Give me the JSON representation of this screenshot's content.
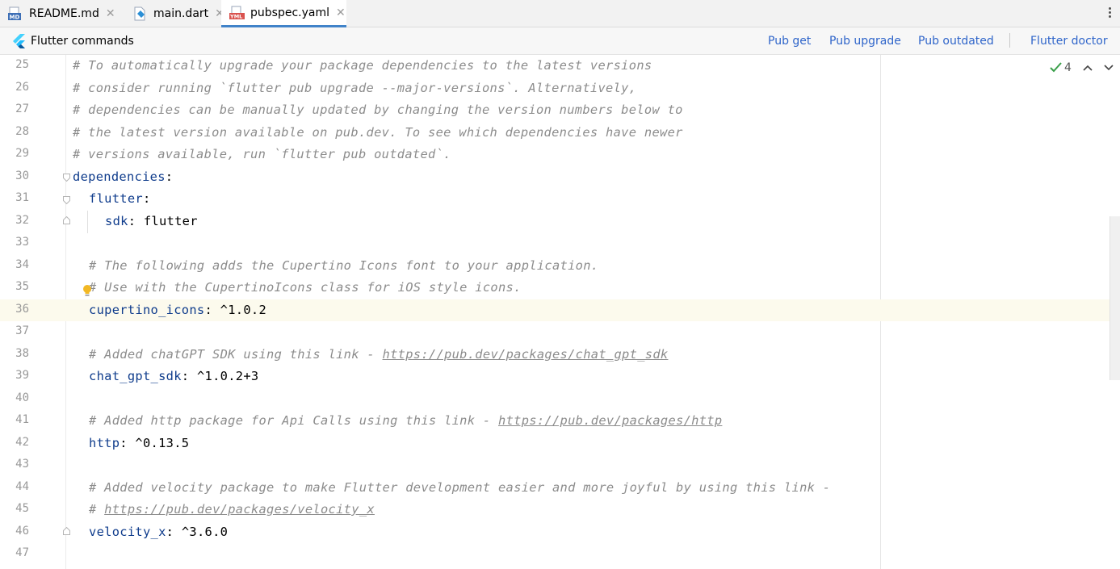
{
  "tabs": [
    {
      "label": "README.md",
      "icon": "markdown-file-icon",
      "active": false
    },
    {
      "label": "main.dart",
      "icon": "dart-file-icon",
      "active": false
    },
    {
      "label": "pubspec.yaml",
      "icon": "yaml-file-icon",
      "active": true
    }
  ],
  "icons": {
    "markdown_badge": "MD",
    "yaml_badge": "YML"
  },
  "commands": {
    "title": "Flutter commands",
    "pub_get": "Pub get",
    "pub_upgrade": "Pub upgrade",
    "pub_outdated": "Pub outdated",
    "flutter_doctor": "Flutter doctor"
  },
  "inspection": {
    "count": "4"
  },
  "lines": [
    {
      "n": "25",
      "text": "# To automatically upgrade your package dependencies to the latest versions"
    },
    {
      "n": "26",
      "text": "# consider running `flutter pub upgrade --major-versions`. Alternatively,"
    },
    {
      "n": "27",
      "text": "# dependencies can be manually updated by changing the version numbers below to"
    },
    {
      "n": "28",
      "text": "# the latest version available on pub.dev. To see which dependencies have newer"
    },
    {
      "n": "29",
      "text": "# versions available, run `flutter pub outdated`."
    },
    {
      "n": "30",
      "key": "dependencies",
      "sep": ":",
      "value": ""
    },
    {
      "n": "31",
      "key": "flutter",
      "sep": ":",
      "value": ""
    },
    {
      "n": "32",
      "key": "sdk",
      "sep": ":",
      "value": " flutter"
    },
    {
      "n": "33"
    },
    {
      "n": "34",
      "text": "# The following adds the Cupertino Icons font to your application."
    },
    {
      "n": "35",
      "text": "# Use with the CupertinoIcons class for iOS style icons."
    },
    {
      "n": "36",
      "key": "cupertino_icons",
      "sep": ":",
      "value": " ^1.0.2"
    },
    {
      "n": "37"
    },
    {
      "n": "38",
      "text": "# Added chatGPT SDK using this link - ",
      "link": "https://pub.dev/packages/chat_gpt_sdk"
    },
    {
      "n": "39",
      "key": "chat_gpt_sdk",
      "sep": ":",
      "value": " ^1.0.2+3"
    },
    {
      "n": "40"
    },
    {
      "n": "41",
      "text": "# Added http package for Api Calls using this link - ",
      "link": "https://pub.dev/packages/http"
    },
    {
      "n": "42",
      "key": "http",
      "sep": ":",
      "value": " ^0.13.5"
    },
    {
      "n": "43"
    },
    {
      "n": "44",
      "text": "# Added velocity package to make Flutter development easier and more joyful by using this link -"
    },
    {
      "n": "45",
      "text": "# ",
      "link": "https://pub.dev/packages/velocity_x"
    },
    {
      "n": "46",
      "key": "velocity_x",
      "sep": ":",
      "value": " ^3.6.0"
    },
    {
      "n": "47"
    }
  ]
}
